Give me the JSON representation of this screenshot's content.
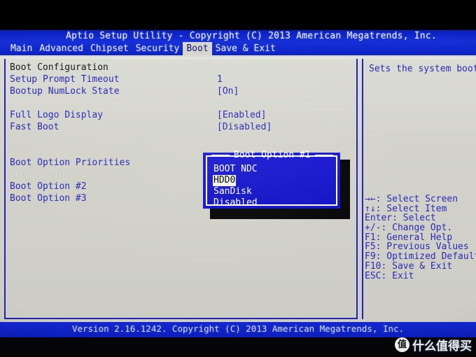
{
  "title": "Aptio Setup Utility - Copyright (C) 2013 American Megatrends, Inc.",
  "menu": {
    "items": [
      {
        "label": "Main",
        "active": false
      },
      {
        "label": "Advanced",
        "active": false
      },
      {
        "label": "Chipset",
        "active": false
      },
      {
        "label": "Security",
        "active": false
      },
      {
        "label": "Boot",
        "active": true
      },
      {
        "label": "Save & Exit",
        "active": false
      }
    ]
  },
  "main": {
    "rows": [
      {
        "label": "Boot Configuration",
        "value": "",
        "style": "heading"
      },
      {
        "label": "Setup Prompt Timeout",
        "value": "1",
        "style": "normal"
      },
      {
        "label": "Bootup NumLock State",
        "value": "[On]",
        "style": "normal"
      },
      {
        "label": "",
        "value": "",
        "style": "spacer"
      },
      {
        "label": "Full Logo Display",
        "value": "[Enabled]",
        "style": "normal"
      },
      {
        "label": "Fast Boot",
        "value": "[Disabled]",
        "style": "normal"
      },
      {
        "label": "",
        "value": "",
        "style": "spacer"
      },
      {
        "label": "",
        "value": "",
        "style": "spacer"
      },
      {
        "label": "Boot Option Priorities",
        "value": "",
        "style": "normal"
      },
      {
        "label": "Boot Option #1",
        "value": "",
        "style": "dim"
      },
      {
        "label": "Boot Option #2",
        "value": "",
        "style": "normal"
      },
      {
        "label": "Boot Option #3",
        "value": "",
        "style": "normal"
      }
    ]
  },
  "dialog": {
    "title": "Boot Option #1",
    "options": [
      {
        "label": "BOOT NDC",
        "selected": false
      },
      {
        "label": "HDD0",
        "selected": true
      },
      {
        "label": "SanDisk",
        "selected": false
      },
      {
        "label": "Disabled",
        "selected": false
      }
    ]
  },
  "help": {
    "text": "Sets the system boot order"
  },
  "keys": [
    {
      "key": "→←",
      "desc": ": Select Screen"
    },
    {
      "key": "↑↓",
      "desc": ": Select Item"
    },
    {
      "key": "Enter",
      "desc": ": Select"
    },
    {
      "key": "+/-",
      "desc": ": Change Opt."
    },
    {
      "key": "F1",
      "desc": ": General Help"
    },
    {
      "key": "F5",
      "desc": ": Previous Values"
    },
    {
      "key": "F9",
      "desc": ": Optimized Defaults"
    },
    {
      "key": "F10",
      "desc": ": Save & Exit"
    },
    {
      "key": "ESC",
      "desc": ": Exit"
    }
  ],
  "footer": {
    "version": "Version 2.16.1242. Copyright (C) 2013 American Megatrends, Inc."
  },
  "watermark": {
    "badge": "值",
    "text": "什么值得买"
  },
  "colors": {
    "title_bar": "#0d22c4",
    "content_bg": "#d4d4cd",
    "text_blue": "#2a2ab8",
    "dialog_bg": "#1414c9",
    "highlight_bg": "#f2f2ee"
  }
}
